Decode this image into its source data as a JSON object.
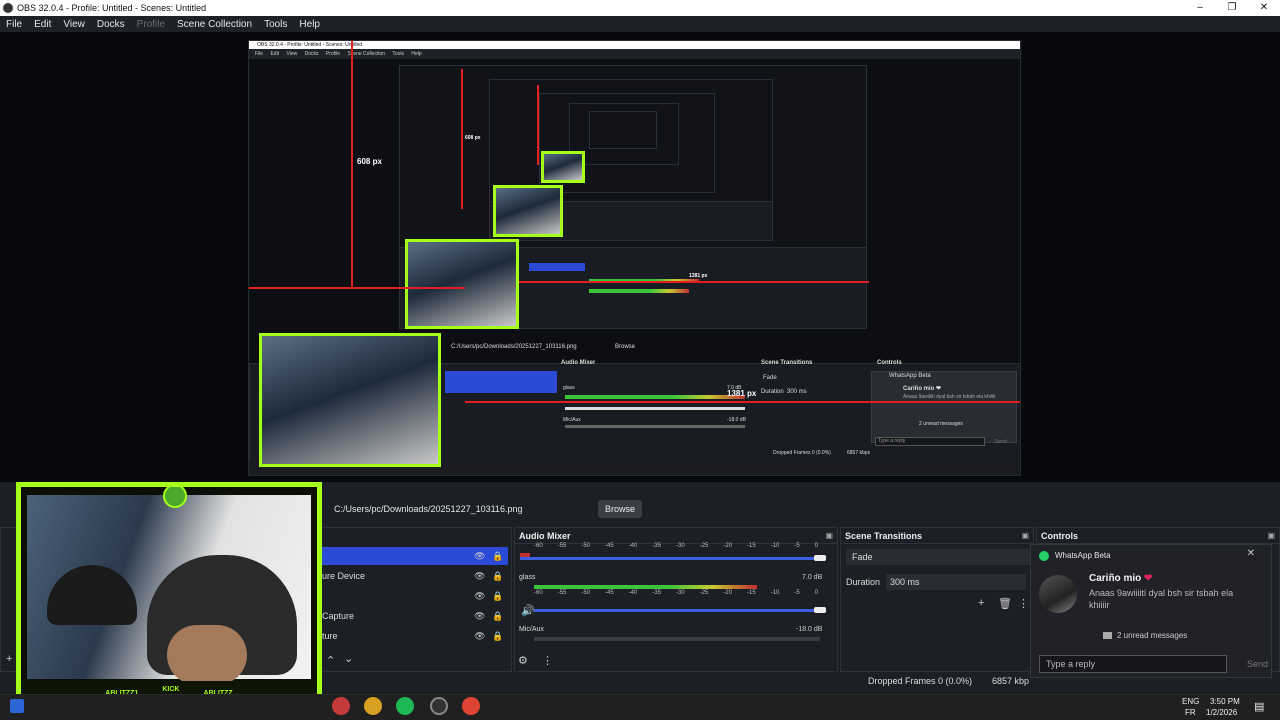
{
  "window": {
    "title": "OBS 32.0.4 - Profile: Untitled - Scenes: Untitled",
    "controls": [
      "–",
      "❐",
      "✕"
    ]
  },
  "menu": [
    "File",
    "Edit",
    "View",
    "Docks",
    "Profile",
    "Scene Collection",
    "Tools",
    "Help"
  ],
  "preview": {
    "nested_title": "OBS 32.0.4 - Profile: Untitled - Scenes: Untitled",
    "nested_menu": [
      "File",
      "Edit",
      "View",
      "Docks",
      "Profile",
      "Scene Collection",
      "Tools",
      "Help"
    ],
    "measure_608": "608 px",
    "measure_608b": "608 px",
    "measure_1381": "1381 px",
    "measure_1381b": "1381 px",
    "nested_path": "C:/Users/pc/Downloads/20251227_103116.png",
    "nested_browse": "Browse",
    "nested_audio_mixer": "Audio Mixer",
    "nested_scene_transitions": "Scene Transitions",
    "nested_controls": "Controls",
    "nested_whatsapp": "WhatsApp Beta",
    "nested_sender": "Cariño mio ❤",
    "nested_msg": "Anaas 9awiiiiti dyal bsh sir tsbah ela khiiiir",
    "nested_unread": "2 unread messages",
    "nested_reply": "Type a reply",
    "nested_send": "Send",
    "nested_fade": "Fade",
    "nested_duration": "Duration",
    "nested_duration_value": "300 ms",
    "nested_glass": "glass",
    "nested_micaux": "Mic/Aux",
    "nested_db1": "7.0 dB",
    "nested_db2": "-18.0 dB",
    "nested_dropped": "Dropped Frames 0 (0.0%)",
    "nested_kbps": "6857 kbps"
  },
  "camera": {
    "tags": [
      "ABLITZZ1",
      "KICK\nABLITZZ",
      "ABLITZZ"
    ]
  },
  "sources": {
    "path": "C:/Users/pc/Downloads/20251227_103116.png",
    "browse": "Browse",
    "items": [
      "ure Device",
      "Capture",
      "ture"
    ]
  },
  "mixer": {
    "title": "Audio Mixer",
    "scale": [
      "-60",
      "-55",
      "-50",
      "-45",
      "-40",
      "-35",
      "-30",
      "-25",
      "-20",
      "-15",
      "-10",
      "-5",
      "0"
    ],
    "channels": [
      {
        "name": "glass",
        "db": "7.0 dB",
        "level": 0.78
      },
      {
        "name": "Mic/Aux",
        "db": "-18.0 dB",
        "level": 0.0
      }
    ]
  },
  "transitions": {
    "title": "Scene Transitions",
    "selected": "Fade",
    "duration_label": "Duration",
    "duration_value": "300 ms"
  },
  "controls": {
    "title": "Controls"
  },
  "notification": {
    "app": "WhatsApp Beta",
    "close": "✕",
    "sender": "Cariño mio",
    "heart": "❤",
    "message": "Anaas 9awiiiiti dyal bsh sir tsbah ela khiiiir",
    "unread": "2 unread messages",
    "reply_placeholder": "Type a reply",
    "send": "Send"
  },
  "status": {
    "dropped": "Dropped Frames 0 (0.0%)",
    "kbps": "6857 kbp"
  },
  "taskbar": {
    "lang": "ENG",
    "region": "FR",
    "time": "3:50 PM",
    "date": "1/2/2026"
  }
}
